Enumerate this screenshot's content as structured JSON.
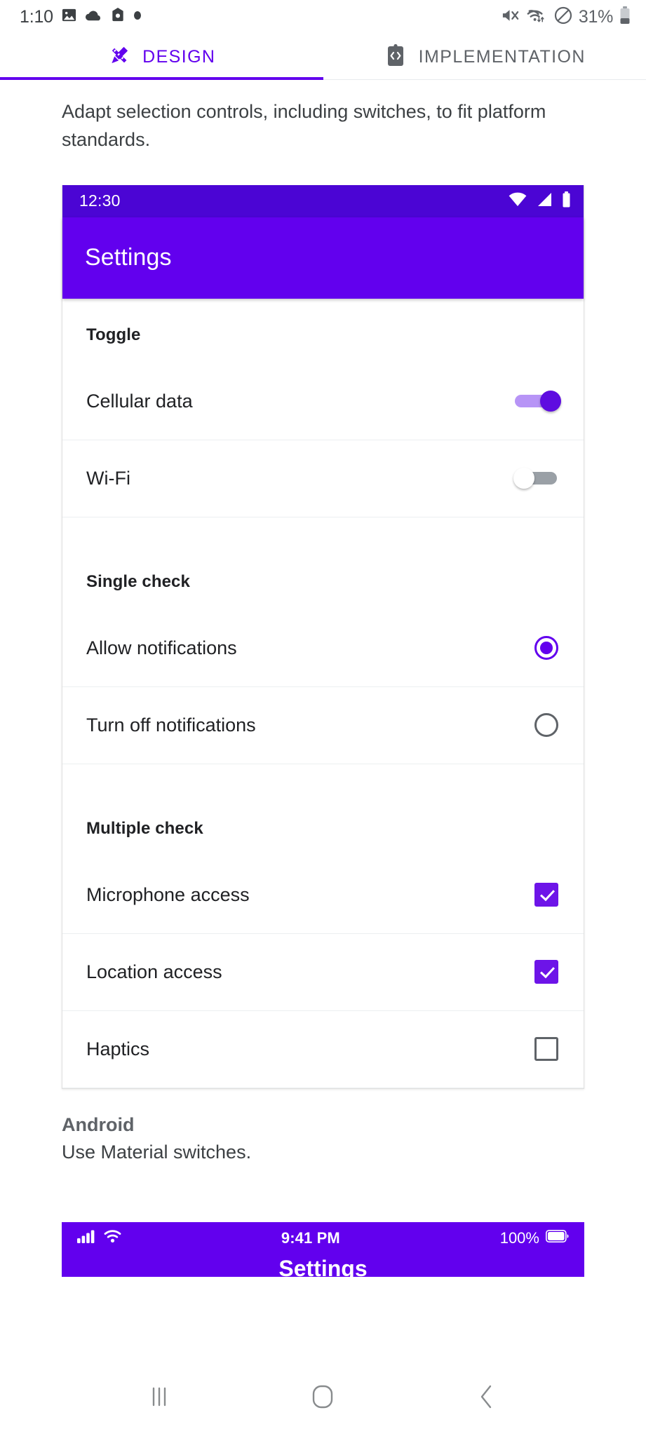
{
  "os_status": {
    "clock": "1:10",
    "battery_percent": "31%",
    "left_icons": [
      "image-icon",
      "cloud-icon",
      "camera-icon",
      "dot-icon"
    ],
    "right_icons": [
      "mute-icon",
      "wifi-data-icon",
      "do-not-disturb-icon",
      "battery-icon"
    ]
  },
  "tabs": [
    {
      "label": "DESIGN",
      "icon": "design-pen-ruler-icon",
      "active": true
    },
    {
      "label": "IMPLEMENTATION",
      "icon": "code-clipboard-icon",
      "active": false
    }
  ],
  "intro": "Adapt selection controls, including switches, to fit platform standards.",
  "android_mock": {
    "status_clock": "12:30",
    "status_icons": [
      "wifi-icon",
      "cellular-signal-icon",
      "battery-icon"
    ],
    "app_title": "Settings",
    "groups": [
      {
        "title": "Toggle",
        "rows": [
          {
            "label": "Cellular data",
            "control": "switch",
            "state": "on"
          },
          {
            "label": "Wi-Fi",
            "control": "switch",
            "state": "off"
          }
        ]
      },
      {
        "title": "Single check",
        "rows": [
          {
            "label": "Allow notifications",
            "control": "radio",
            "state": "checked"
          },
          {
            "label": "Turn off notifications",
            "control": "radio",
            "state": "unchecked"
          }
        ]
      },
      {
        "title": "Multiple check",
        "rows": [
          {
            "label": "Microphone access",
            "control": "checkbox",
            "state": "checked"
          },
          {
            "label": "Location access",
            "control": "checkbox",
            "state": "checked"
          },
          {
            "label": "Haptics",
            "control": "checkbox",
            "state": "unchecked"
          }
        ]
      }
    ]
  },
  "platform_note": {
    "title": "Android",
    "body": "Use Material switches."
  },
  "ios_mock": {
    "time": "9:41 PM",
    "battery_percent": "100%",
    "title": "Settings",
    "left_icons": [
      "cellular-bars-icon",
      "wifi-icon"
    ],
    "right_icons": [
      "battery-icon"
    ]
  },
  "navbar": {
    "buttons": [
      {
        "name": "recents-button",
        "icon": "recents-icon"
      },
      {
        "name": "home-button",
        "icon": "home-icon"
      },
      {
        "name": "back-button",
        "icon": "back-chevron-icon"
      }
    ]
  },
  "colors": {
    "accent": "#6200ee",
    "status_dark": "#4b05d4",
    "checkbox": "#6d14e8",
    "switch_track_on": "#b794f6",
    "switch_thumb_on": "#5e0ce0"
  }
}
